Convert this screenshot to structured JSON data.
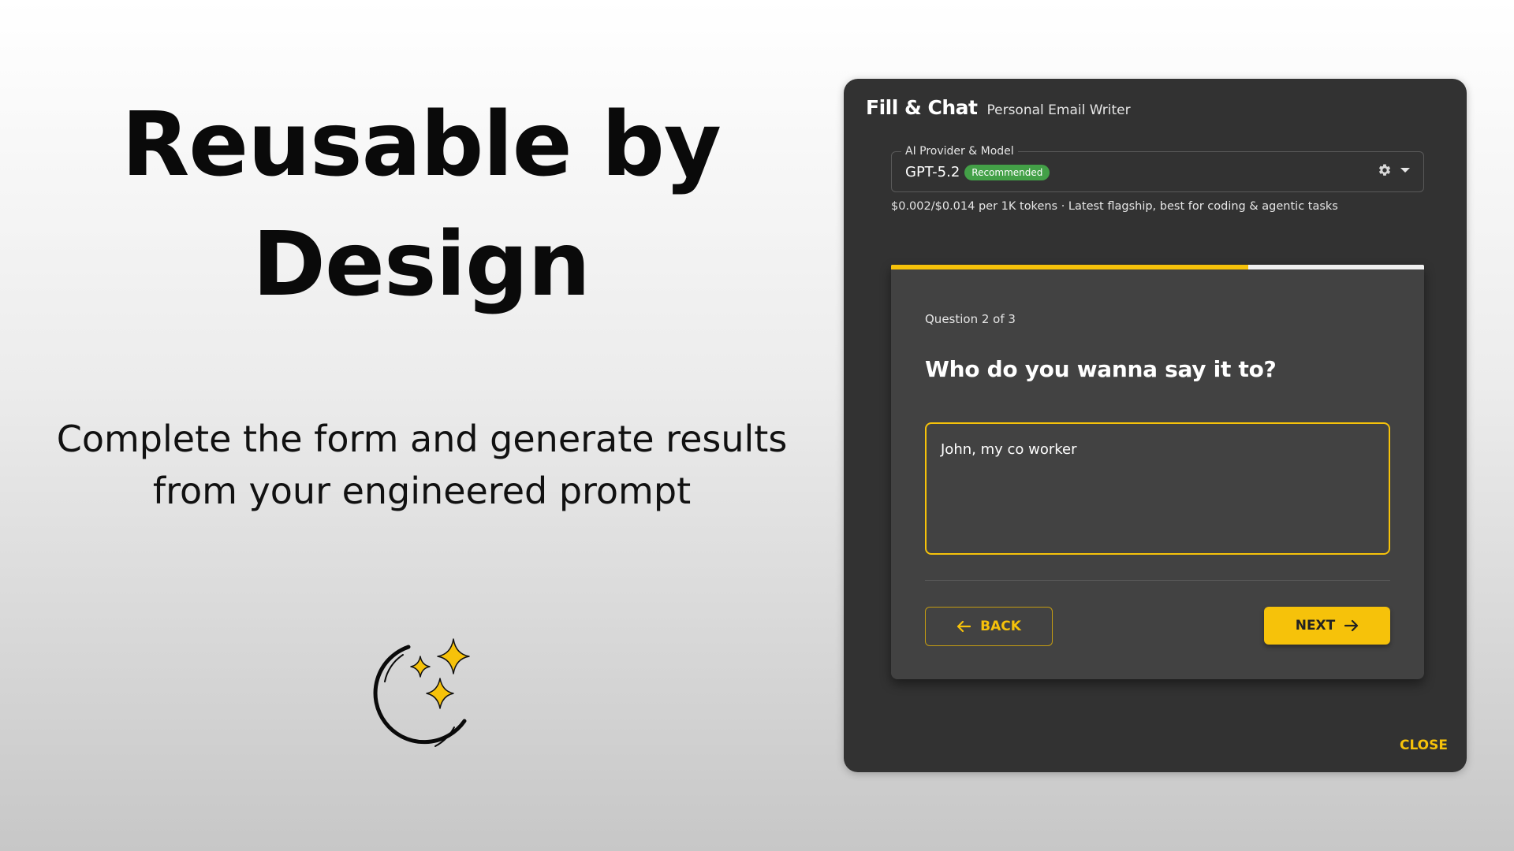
{
  "hero": {
    "title": "Reusable by Design",
    "subtitle": "Complete the form and generate results from your engineered prompt",
    "logo_icon": "sparkle-crescent-icon"
  },
  "dialog": {
    "app_title": "Fill & Chat",
    "app_subtitle": "Personal Email Writer",
    "model_select": {
      "label": "AI Provider & Model",
      "value": "GPT-5.2",
      "badge": "Recommended",
      "hint": "$0.002/$0.014 per 1K tokens · Latest flagship, best for coding & agentic tasks"
    },
    "progress_fraction": 0.67,
    "question_counter": "Question 2 of 3",
    "question": "Who do you wanna say it to?",
    "answer_value": "John, my co worker",
    "back_label": "BACK",
    "next_label": "NEXT",
    "close_label": "CLOSE"
  },
  "colors": {
    "accent": "#f6c20a",
    "dialog_bg": "#323232",
    "card_bg": "#424242",
    "badge_green": "#43a047"
  }
}
